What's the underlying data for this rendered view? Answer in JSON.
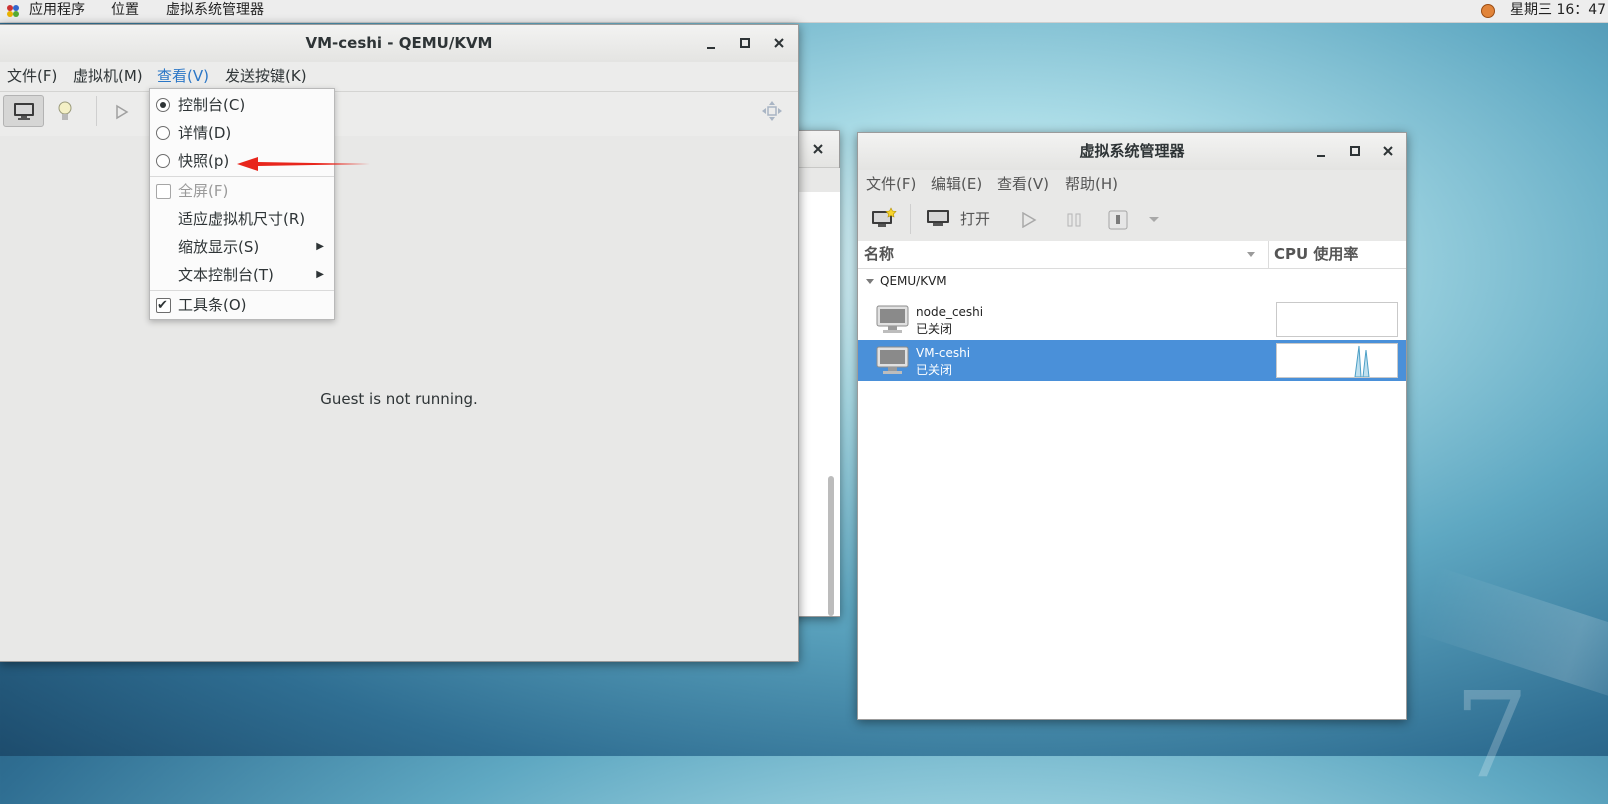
{
  "topbar": {
    "apps": "应用程序",
    "places": "位置",
    "app_name": "虚拟系统管理器",
    "clock": "星期三 16：47"
  },
  "console": {
    "title": "VM-ceshi - QEMU/KVM",
    "menu": [
      "文件(F)",
      "虚拟机(M)",
      "查看(V)",
      "发送按键(K)"
    ],
    "status": "Guest is not running."
  },
  "view_menu": {
    "items": [
      {
        "label": "控制台(C)",
        "type": "radio",
        "checked": true
      },
      {
        "label": "详情(D)",
        "type": "radio",
        "checked": false
      },
      {
        "label": "快照(p)",
        "type": "radio",
        "checked": false
      },
      {
        "label": "全屏(F)",
        "type": "check",
        "checked": false,
        "disabled": true
      },
      {
        "label": "适应虚拟机尺寸(R)",
        "type": "plain"
      },
      {
        "label": "缩放显示(S)",
        "type": "submenu"
      },
      {
        "label": "文本控制台(T)",
        "type": "submenu"
      },
      {
        "label": "工具条(O)",
        "type": "check",
        "checked": true
      }
    ]
  },
  "manager": {
    "title": "虚拟系统管理器",
    "menu": [
      "文件(F)",
      "编辑(E)",
      "查看(V)",
      "帮助(H)"
    ],
    "toolbar": {
      "open": "打开"
    },
    "columns": {
      "name": "名称",
      "cpu": "CPU 使用率"
    },
    "group": "QEMU/KVM",
    "vms": [
      {
        "name": "node_ceshi",
        "state": "已关闭",
        "selected": false,
        "cpu_spike": false
      },
      {
        "name": "VM-ceshi",
        "state": "已关闭",
        "selected": true,
        "cpu_spike": true
      }
    ]
  },
  "colors": {
    "selection": "#4a90d9",
    "menu_active": "#2a76c6",
    "annotation_arrow": "#e8261c"
  },
  "icons": {
    "apps": "apps-icon",
    "tray": "tray-icon",
    "console_view": "monitor-icon",
    "details_view": "lightbulb-icon",
    "run": "play-icon",
    "fullscreen": "move-icon"
  }
}
